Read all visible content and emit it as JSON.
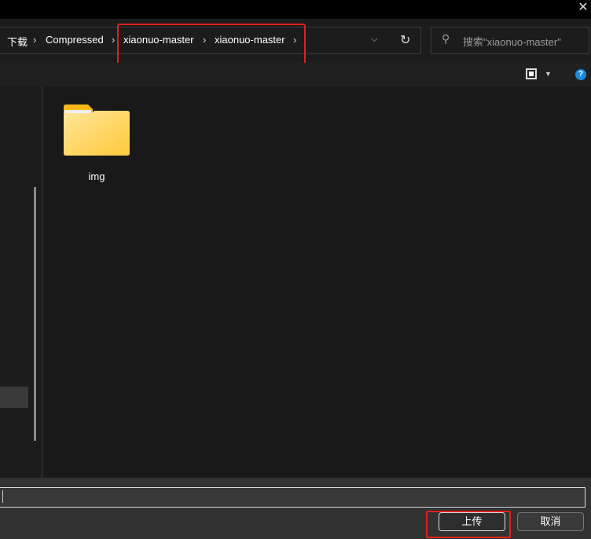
{
  "breadcrumb": [
    "下载",
    "Compressed",
    "xiaonuo-master",
    "xiaonuo-master"
  ],
  "search": {
    "placeholder": "搜索\"xiaonuo-master\""
  },
  "files": [
    {
      "name": "img",
      "type": "folder"
    }
  ],
  "filename": {
    "value": ""
  },
  "buttons": {
    "upload": "上传",
    "cancel": "取消"
  },
  "close_glyph": "✕",
  "help_glyph": "?",
  "colors": {
    "highlight": "#e0201a",
    "folder": "#ffd35c"
  }
}
